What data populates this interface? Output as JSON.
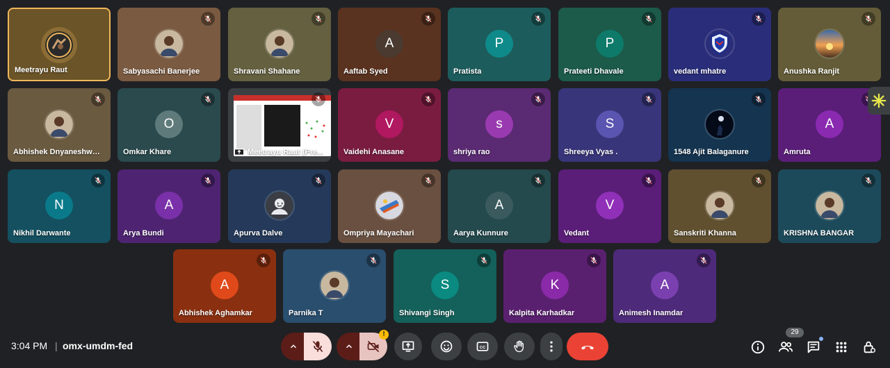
{
  "participants": [
    {
      "name": "Meetrayu Raut",
      "avatar": "photo-gear",
      "bg": "#6b5428",
      "speaking": true,
      "muted": false
    },
    {
      "name": "Sabyasachi Banerjee",
      "avatar": "photo-person",
      "bg": "#7a5a40",
      "muted": true
    },
    {
      "name": "Shravani Shahane",
      "avatar": "photo-person",
      "bg": "#646040",
      "muted": true
    },
    {
      "name": "Aaftab Syed",
      "initial": "A",
      "bg": "#5a3220",
      "avcolor": "#4a3a30",
      "muted": true
    },
    {
      "name": "Pratista",
      "initial": "P",
      "bg": "#1d5c5c",
      "avcolor": "#0f8a8a",
      "muted": true
    },
    {
      "name": "Prateeti Dhavale",
      "initial": "P",
      "bg": "#1c5a4a",
      "avcolor": "#0d7a6a",
      "muted": true
    },
    {
      "name": "vedant mhatre",
      "avatar": "photo-shield",
      "bg": "#2a2e7a",
      "muted": true
    },
    {
      "name": "Anushka Ranjit",
      "avatar": "photo-sunset",
      "bg": "#645c38",
      "muted": true
    },
    {
      "name": "Abhishek Dnyaneshwar ...",
      "avatar": "photo-person",
      "bg": "#6a5a40",
      "muted": true
    },
    {
      "name": "Omkar Khare",
      "initial": "O",
      "bg": "#2a4a4e",
      "avcolor": "#5f7a7a",
      "muted": true
    },
    {
      "name": "Meetrayu Raut (Pre...",
      "screen": true,
      "bg": "#3c4043",
      "muted": true
    },
    {
      "name": "Vaidehi Anasane",
      "initial": "V",
      "bg": "#7a1c40",
      "avcolor": "#b01860",
      "muted": true
    },
    {
      "name": "shriya rao",
      "initial": "s",
      "bg": "#5a2a72",
      "avcolor": "#9a3ab0",
      "muted": true
    },
    {
      "name": "Shreeya Vyas .",
      "initial": "S",
      "bg": "#38357a",
      "avcolor": "#5a55b0",
      "muted": true
    },
    {
      "name": "1548 Ajit Balaganure",
      "avatar": "photo-dark",
      "bg": "#143450",
      "muted": true
    },
    {
      "name": "Amruta",
      "initial": "A",
      "bg": "#5a1e78",
      "avcolor": "#8a2ab0",
      "muted": true
    },
    {
      "name": "Nikhil Darwante",
      "initial": "N",
      "bg": "#145060",
      "avcolor": "#0a7a8a",
      "muted": true
    },
    {
      "name": "Arya Bundi",
      "initial": "A",
      "bg": "#4e2472",
      "avcolor": "#7a30a8",
      "muted": true
    },
    {
      "name": "Apurva Dalve",
      "avatar": "photo-generic",
      "bg": "#253a5a",
      "muted": true
    },
    {
      "name": "Ompriya Mayachari",
      "avatar": "photo-colorful",
      "bg": "#6a5040",
      "muted": true
    },
    {
      "name": "Aarya Kunnure",
      "initial": "A",
      "bg": "#244a4e",
      "avcolor": "#3a5a5e",
      "muted": true
    },
    {
      "name": "Vedant",
      "initial": "V",
      "bg": "#5a1e78",
      "avcolor": "#9030b8",
      "muted": true
    },
    {
      "name": "Sanskriti Khanna",
      "avatar": "photo-person",
      "bg": "#605030",
      "muted": true
    },
    {
      "name": "KRISHNA BANGAR",
      "avatar": "photo-person",
      "bg": "#1c4a5a",
      "muted": true
    },
    {
      "name": "Abhishek Aghamkar",
      "initial": "A",
      "bg": "#8a3010",
      "avcolor": "#e04a1a",
      "muted": true
    },
    {
      "name": "Parnika T",
      "avatar": "photo-person",
      "bg": "#2a4e6e",
      "muted": true
    },
    {
      "name": "Shivangi Singh",
      "initial": "S",
      "bg": "#14605a",
      "avcolor": "#0a8a80",
      "muted": true
    },
    {
      "name": "Kalpita Karhadkar",
      "initial": "K",
      "bg": "#5a2070",
      "avcolor": "#8a2aa8",
      "muted": true
    },
    {
      "name": "Animesh Inamdar",
      "initial": "A",
      "bg": "#4e2a7a",
      "avcolor": "#7a40b0",
      "muted": true
    }
  ],
  "bottom_bar": {
    "time": "3:04 PM",
    "separator": "|",
    "meeting_code": "omx-umdm-fed",
    "participant_count": "29"
  },
  "colors": {
    "hangup": "#ea4335",
    "mic_off_bg": "#f9dedc",
    "dark_red": "#5c1d18",
    "speaking_border": "#f0b75a"
  },
  "icons": [
    "chevron-up-icon",
    "mic-off-icon",
    "camera-off-icon",
    "alert-icon",
    "present-icon",
    "emoji-icon",
    "captions-icon",
    "raise-hand-icon",
    "more-icon",
    "hangup-icon",
    "info-icon",
    "people-icon",
    "chat-icon",
    "activities-icon",
    "host-controls-icon",
    "spark-icon"
  ]
}
